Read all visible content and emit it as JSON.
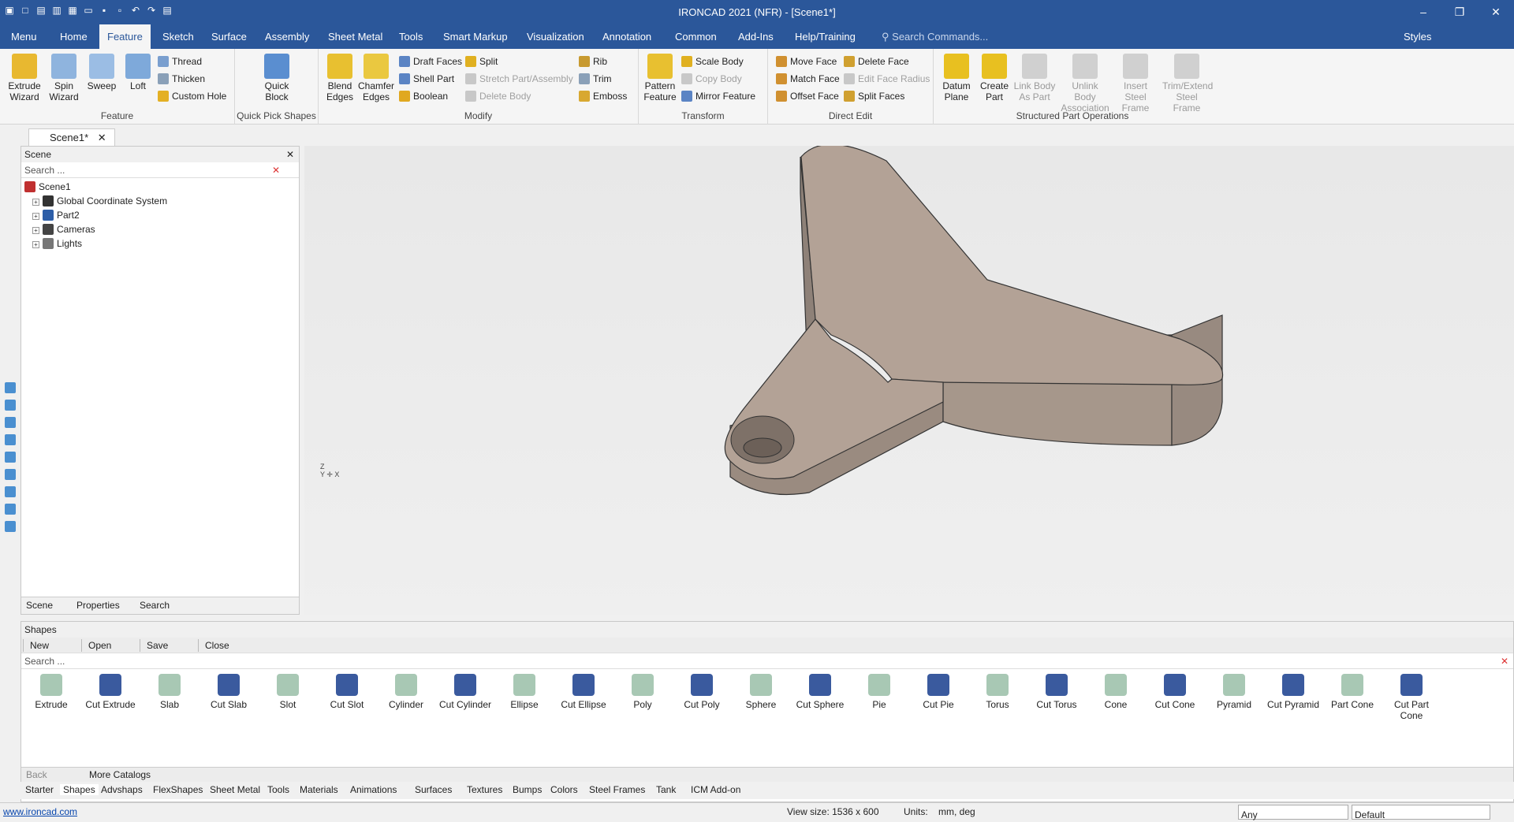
{
  "app": {
    "title": "IRONCAD 2021 (NFR) - [Scene1*]"
  },
  "menu": {
    "tabs": [
      "Menu",
      "Home",
      "Feature",
      "Sketch",
      "Surface",
      "Assembly",
      "Sheet Metal",
      "Tools",
      "Smart Markup",
      "Visualization",
      "Annotation",
      "Common",
      "Add-Ins",
      "Help/Training"
    ],
    "active": "Feature",
    "search_placeholder": "Search Commands...",
    "styles": "Styles"
  },
  "ribbon": {
    "feature": {
      "label": "Feature",
      "extrude": "Extrude Wizard",
      "spin": "Spin Wizard",
      "sweep": "Sweep",
      "loft": "Loft",
      "thread": "Thread",
      "thicken": "Thicken",
      "custom_hole": "Custom Hole"
    },
    "quick": {
      "label": "Quick Pick Shapes",
      "quick_block": "Quick Block"
    },
    "modify": {
      "label": "Modify",
      "blend": "Blend Edges",
      "chamfer": "Chamfer Edges",
      "draft": "Draft Faces",
      "shell": "Shell Part",
      "boolean": "Boolean",
      "split": "Split",
      "stretch": "Stretch Part/Assembly",
      "delete_body": "Delete Body",
      "rib": "Rib",
      "trim": "Trim",
      "emboss": "Emboss"
    },
    "transform": {
      "label": "Transform",
      "pattern": "Pattern Feature",
      "scale": "Scale Body",
      "copy": "Copy Body",
      "mirror": "Mirror Feature"
    },
    "direct": {
      "label": "Direct Edit",
      "move_face": "Move Face",
      "match_face": "Match Face",
      "offset_face": "Offset Face",
      "delete_face": "Delete Face",
      "edit_radius": "Edit Face Radius",
      "split_faces": "Split Faces"
    },
    "structured": {
      "label": "Structured Part Operations",
      "datum": "Datum Plane",
      "create_part": "Create Part",
      "link_body": "Link Body As Part",
      "unlink": "Unlink Body Association",
      "insert_steel": "Insert Steel Frame",
      "trim_steel": "Trim/Extend Steel Frame"
    }
  },
  "doc_tab": "Scene1*",
  "scene_panel": {
    "title": "Scene",
    "search": "Search ...",
    "tree": [
      "Scene1",
      "Global Coordinate System",
      "Part2",
      "Cameras",
      "Lights"
    ],
    "tabs": [
      "Scene",
      "Properties",
      "Search"
    ]
  },
  "shapes_panel": {
    "title": "Shapes",
    "buttons": [
      "New",
      "Open",
      "Save",
      "Close"
    ],
    "search": "Search ...",
    "items": [
      "Extrude",
      "Cut Extrude",
      "Slab",
      "Cut Slab",
      "Slot",
      "Cut Slot",
      "Cylinder",
      "Cut Cylinder",
      "Ellipse",
      "Cut Ellipse",
      "Poly",
      "Cut Poly",
      "Sphere",
      "Cut Sphere",
      "Pie",
      "Cut Pie",
      "Torus",
      "Cut Torus",
      "Cone",
      "Cut Cone",
      "Pyramid",
      "Cut Pyramid",
      "Part Cone",
      "Cut Part Cone"
    ],
    "back": "Back",
    "more": "More Catalogs",
    "catalog_tabs": [
      "Starter",
      "Shapes",
      "Advshaps",
      "FlexShapes",
      "Sheet Metal",
      "Tools",
      "Materials",
      "Animations",
      "Surfaces",
      "Textures",
      "Bumps",
      "Colors",
      "Steel Frames",
      "Tank",
      "ICM Add-on"
    ]
  },
  "status": {
    "link": "www.ironcad.com",
    "view_size": "View size: 1536 x  600",
    "units_label": "Units:",
    "units": "mm, deg",
    "filter": "Any",
    "style": "Default"
  },
  "colors": {
    "titlebar": "#2b579a",
    "part": "#b3a296"
  }
}
